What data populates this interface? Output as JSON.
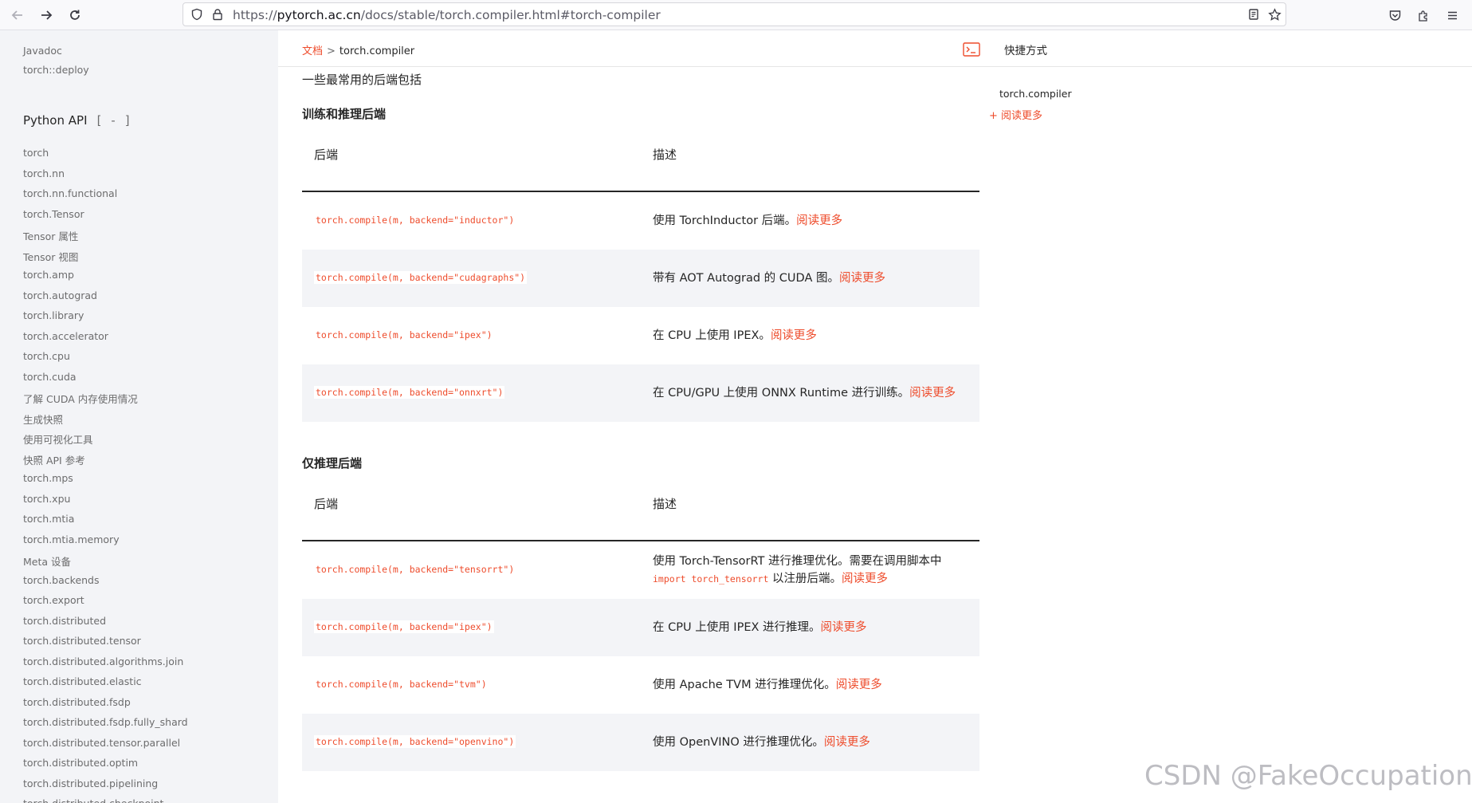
{
  "browser": {
    "url_prefix": "https://",
    "url_host": "pytorch.ac.cn",
    "url_path": "/docs/stable/torch.compiler.html#torch-compiler"
  },
  "sidebar": {
    "top_links": [
      "Javadoc",
      "torch::deploy"
    ],
    "section_title": "Python API",
    "section_toggle": "[ - ]",
    "items": [
      "torch",
      "torch.nn",
      "torch.nn.functional",
      "torch.Tensor",
      "Tensor 属性",
      "Tensor 视图",
      "torch.amp",
      "torch.autograd",
      "torch.library",
      "torch.accelerator",
      "torch.cpu",
      "torch.cuda",
      "了解 CUDA 内存使用情况",
      "生成快照",
      "使用可视化工具",
      "快照 API 参考",
      "torch.mps",
      "torch.xpu",
      "torch.mtia",
      "torch.mtia.memory",
      "Meta 设备",
      "torch.backends",
      "torch.export",
      "torch.distributed",
      "torch.distributed.tensor",
      "torch.distributed.algorithms.join",
      "torch.distributed.elastic",
      "torch.distributed.fsdp",
      "torch.distributed.fsdp.fully_shard",
      "torch.distributed.tensor.parallel",
      "torch.distributed.optim",
      "torch.distributed.pipelining",
      "torch.distributed.checkpoint"
    ]
  },
  "breadcrumb": {
    "home": "文档",
    "separator": ">",
    "current": "torch.compiler"
  },
  "right_panel": {
    "title": "快捷方式",
    "toc_item": "torch.compiler",
    "read_more": "+ 阅读更多"
  },
  "main": {
    "intro": "一些最常用的后端包括",
    "training": {
      "title": "训练和推理后端",
      "col_backend": "后端",
      "col_desc": "描述",
      "rows": [
        {
          "code": "torch.compile(m, backend=\"inductor\")",
          "desc": "使用 TorchInductor 后端。",
          "more": "阅读更多"
        },
        {
          "code": "torch.compile(m, backend=\"cudagraphs\")",
          "desc": "带有 AOT Autograd 的 CUDA 图。",
          "more": "阅读更多"
        },
        {
          "code": "torch.compile(m, backend=\"ipex\")",
          "desc": "在 CPU 上使用 IPEX。",
          "more": "阅读更多"
        },
        {
          "code": "torch.compile(m, backend=\"onnxrt\")",
          "desc": "在 CPU/GPU 上使用 ONNX Runtime 进行训练。",
          "more": "阅读更多"
        }
      ]
    },
    "inference": {
      "title": "仅推理后端",
      "col_backend": "后端",
      "col_desc": "描述",
      "rows": [
        {
          "code": "torch.compile(m, backend=\"tensorrt\")",
          "desc": "使用 Torch-TensorRT 进行推理优化。需要在调用脚本中",
          "inline_code": "import torch_tensorrt",
          "desc2": " 以注册后端。",
          "more": "阅读更多"
        },
        {
          "code": "torch.compile(m, backend=\"ipex\")",
          "desc": "在 CPU 上使用 IPEX 进行推理。",
          "more": "阅读更多"
        },
        {
          "code": "torch.compile(m, backend=\"tvm\")",
          "desc": "使用 Apache TVM 进行推理优化。",
          "more": "阅读更多"
        },
        {
          "code": "torch.compile(m, backend=\"openvino\")",
          "desc": "使用 OpenVINO 进行推理优化。",
          "more": "阅读更多"
        }
      ]
    }
  },
  "watermark": "CSDN @FakeOccupational"
}
